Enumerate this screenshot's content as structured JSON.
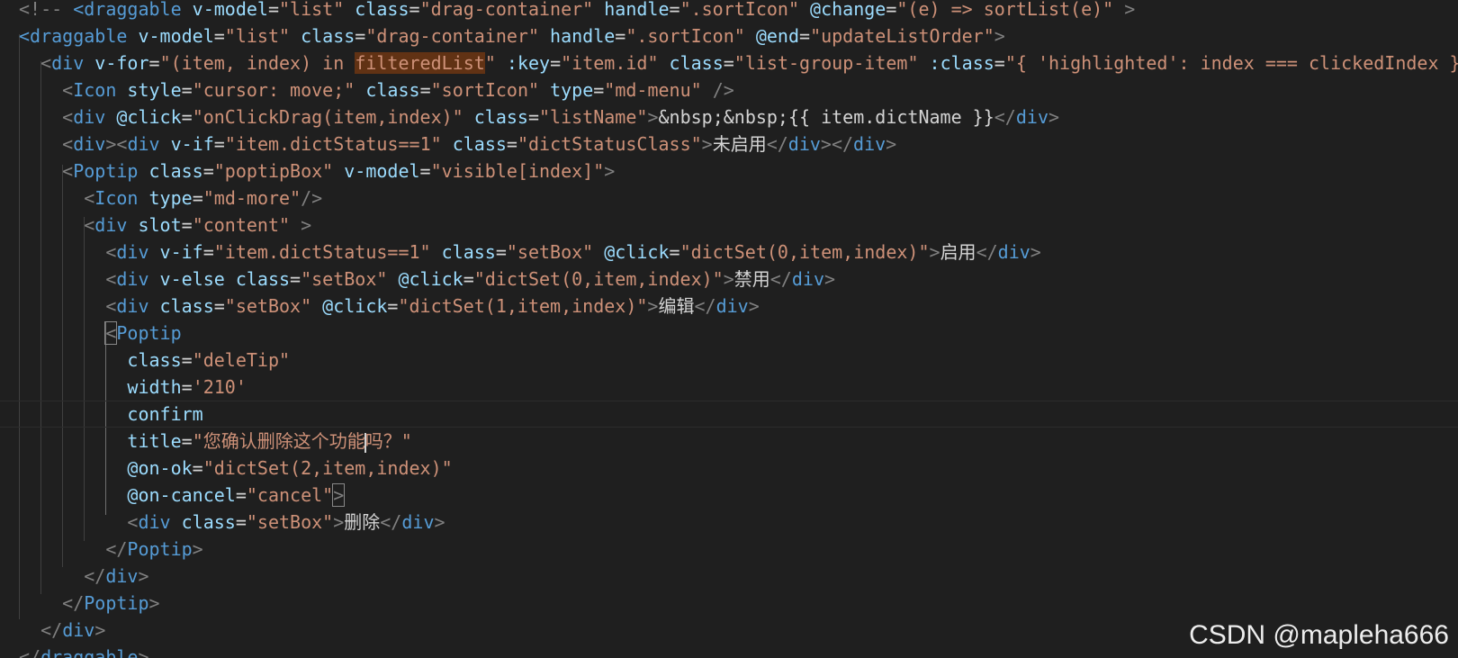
{
  "editor": {
    "language": "vue-template",
    "colors": {
      "background": "#1f1f1f",
      "tag": "#569cd6",
      "attribute": "#9cdcfe",
      "string": "#ce9178",
      "punctuation": "#808080",
      "text": "#d4d4d4",
      "function": "#dcdcaa",
      "number": "#b5cea8",
      "highlight": "#613214"
    },
    "cursor_line": 15,
    "lines": [
      [
        [
          "punc",
          "<!-- "
        ],
        [
          "tag",
          "<draggable"
        ],
        [
          "attr",
          " v-model"
        ],
        [
          "text",
          "="
        ],
        [
          "str",
          "\"list\""
        ],
        [
          "attr",
          " class"
        ],
        [
          "text",
          "="
        ],
        [
          "str",
          "\"drag-container\""
        ],
        [
          "attr",
          " handle"
        ],
        [
          "text",
          "="
        ],
        [
          "str",
          "\".sortIcon\""
        ],
        [
          "attr",
          " @change"
        ],
        [
          "text",
          "="
        ],
        [
          "str",
          "\"(e) => sortList(e)\""
        ],
        [
          "punc",
          " >"
        ]
      ],
      [
        [
          "tag",
          "<draggable"
        ],
        [
          "attr",
          " v-model"
        ],
        [
          "text",
          "="
        ],
        [
          "str",
          "\"list\""
        ],
        [
          "attr",
          " class"
        ],
        [
          "text",
          "="
        ],
        [
          "str",
          "\"drag-container\""
        ],
        [
          "attr",
          " handle"
        ],
        [
          "text",
          "="
        ],
        [
          "str",
          "\".sortIcon\""
        ],
        [
          "attr",
          " @end"
        ],
        [
          "text",
          "="
        ],
        [
          "str",
          "\"updateListOrder\""
        ],
        [
          "punc",
          ">"
        ]
      ],
      [
        [
          "text",
          "  "
        ],
        [
          "punc",
          "<"
        ],
        [
          "tag",
          "div"
        ],
        [
          "attr",
          " v-for"
        ],
        [
          "text",
          "="
        ],
        [
          "str",
          "\"(item, index) in "
        ],
        [
          "hl",
          "filteredList"
        ],
        [
          "str",
          "\""
        ],
        [
          "attr",
          " :key"
        ],
        [
          "text",
          "="
        ],
        [
          "str",
          "\"item.id\""
        ],
        [
          "attr",
          " class"
        ],
        [
          "text",
          "="
        ],
        [
          "str",
          "\"list-group-item\""
        ],
        [
          "attr",
          " :class"
        ],
        [
          "text",
          "="
        ],
        [
          "str",
          "\"{ 'highlighted': index === clickedIndex }\""
        ],
        [
          "punc",
          ">"
        ]
      ],
      [
        [
          "text",
          "    "
        ],
        [
          "punc",
          "<"
        ],
        [
          "tag",
          "Icon"
        ],
        [
          "attr",
          " style"
        ],
        [
          "text",
          "="
        ],
        [
          "str",
          "\"cursor: move;\""
        ],
        [
          "attr",
          " class"
        ],
        [
          "text",
          "="
        ],
        [
          "str",
          "\"sortIcon\""
        ],
        [
          "attr",
          " type"
        ],
        [
          "text",
          "="
        ],
        [
          "str",
          "\"md-menu\""
        ],
        [
          "punc",
          " />"
        ]
      ],
      [
        [
          "text",
          "    "
        ],
        [
          "punc",
          "<"
        ],
        [
          "tag",
          "div"
        ],
        [
          "attr",
          " @click"
        ],
        [
          "text",
          "="
        ],
        [
          "str",
          "\"onClickDrag(item,index)\""
        ],
        [
          "attr",
          " class"
        ],
        [
          "text",
          "="
        ],
        [
          "str",
          "\"listName\""
        ],
        [
          "punc",
          ">"
        ],
        [
          "text",
          "&nbsp;&nbsp;{{ item.dictName }}"
        ],
        [
          "punc",
          "</"
        ],
        [
          "tag",
          "div"
        ],
        [
          "punc",
          ">"
        ]
      ],
      [
        [
          "text",
          "    "
        ],
        [
          "punc",
          "<"
        ],
        [
          "tag",
          "div"
        ],
        [
          "punc",
          "><"
        ],
        [
          "tag",
          "div"
        ],
        [
          "attr",
          " v-if"
        ],
        [
          "text",
          "="
        ],
        [
          "str",
          "\"item.dictStatus==1\""
        ],
        [
          "attr",
          " class"
        ],
        [
          "text",
          "="
        ],
        [
          "str",
          "\"dictStatusClass\""
        ],
        [
          "punc",
          ">"
        ],
        [
          "text",
          "未启用"
        ],
        [
          "punc",
          "</"
        ],
        [
          "tag",
          "div"
        ],
        [
          "punc",
          "></"
        ],
        [
          "tag",
          "div"
        ],
        [
          "punc",
          ">"
        ]
      ],
      [
        [
          "text",
          "    "
        ],
        [
          "punc",
          "<"
        ],
        [
          "tag",
          "Poptip"
        ],
        [
          "attr",
          " class"
        ],
        [
          "text",
          "="
        ],
        [
          "str",
          "\"poptipBox\""
        ],
        [
          "attr",
          " v-model"
        ],
        [
          "text",
          "="
        ],
        [
          "str",
          "\"visible[index]\""
        ],
        [
          "punc",
          ">"
        ]
      ],
      [
        [
          "text",
          "      "
        ],
        [
          "punc",
          "<"
        ],
        [
          "tag",
          "Icon"
        ],
        [
          "attr",
          " type"
        ],
        [
          "text",
          "="
        ],
        [
          "str",
          "\"md-more\""
        ],
        [
          "punc",
          "/>"
        ]
      ],
      [
        [
          "text",
          "      "
        ],
        [
          "punc",
          "<"
        ],
        [
          "tag",
          "div"
        ],
        [
          "attr",
          " slot"
        ],
        [
          "text",
          "="
        ],
        [
          "str",
          "\"content\""
        ],
        [
          "punc",
          " >"
        ]
      ],
      [
        [
          "text",
          "        "
        ],
        [
          "punc",
          "<"
        ],
        [
          "tag",
          "div"
        ],
        [
          "attr",
          " v-if"
        ],
        [
          "text",
          "="
        ],
        [
          "str",
          "\"item.dictStatus==1\""
        ],
        [
          "attr",
          " class"
        ],
        [
          "text",
          "="
        ],
        [
          "str",
          "\"setBox\""
        ],
        [
          "attr",
          " @click"
        ],
        [
          "text",
          "="
        ],
        [
          "str",
          "\"dictSet(0,item,index)\""
        ],
        [
          "punc",
          ">"
        ],
        [
          "text",
          "启用"
        ],
        [
          "punc",
          "</"
        ],
        [
          "tag",
          "div"
        ],
        [
          "punc",
          ">"
        ]
      ],
      [
        [
          "text",
          "        "
        ],
        [
          "punc",
          "<"
        ],
        [
          "tag",
          "div"
        ],
        [
          "attr",
          " v-else"
        ],
        [
          "attr",
          " class"
        ],
        [
          "text",
          "="
        ],
        [
          "str",
          "\"setBox\""
        ],
        [
          "attr",
          " @click"
        ],
        [
          "text",
          "="
        ],
        [
          "str",
          "\"dictSet(0,item,index)\""
        ],
        [
          "punc",
          ">"
        ],
        [
          "text",
          "禁用"
        ],
        [
          "punc",
          "</"
        ],
        [
          "tag",
          "div"
        ],
        [
          "punc",
          ">"
        ]
      ],
      [
        [
          "text",
          "        "
        ],
        [
          "punc",
          "<"
        ],
        [
          "tag",
          "div"
        ],
        [
          "attr",
          " class"
        ],
        [
          "text",
          "="
        ],
        [
          "str",
          "\"setBox\""
        ],
        [
          "attr",
          " @click"
        ],
        [
          "text",
          "="
        ],
        [
          "str",
          "\"dictSet(1,item,index)\""
        ],
        [
          "punc",
          ">"
        ],
        [
          "text",
          "编辑"
        ],
        [
          "punc",
          "</"
        ],
        [
          "tag",
          "div"
        ],
        [
          "punc",
          ">"
        ]
      ],
      [
        [
          "text",
          "        "
        ],
        [
          "bracket",
          "<"
        ],
        [
          "tag",
          "Poptip"
        ]
      ],
      [
        [
          "text",
          "          "
        ],
        [
          "attr",
          "class"
        ],
        [
          "text",
          "="
        ],
        [
          "str",
          "\"deleTip\""
        ]
      ],
      [
        [
          "text",
          "          "
        ],
        [
          "attr",
          "width"
        ],
        [
          "text",
          "="
        ],
        [
          "str",
          "'210'"
        ]
      ],
      [
        [
          "text",
          "          "
        ],
        [
          "attr",
          "confirm"
        ]
      ],
      [
        [
          "text",
          "          "
        ],
        [
          "attr",
          "title"
        ],
        [
          "text",
          "="
        ],
        [
          "str",
          "\"您确认删除这个功能"
        ],
        [
          "cursor",
          ""
        ],
        [
          "str",
          "吗？\""
        ]
      ],
      [
        [
          "text",
          "          "
        ],
        [
          "attr",
          "@on-ok"
        ],
        [
          "text",
          "="
        ],
        [
          "str",
          "\"dictSet(2,item,index)\""
        ]
      ],
      [
        [
          "text",
          "          "
        ],
        [
          "attr",
          "@on-cancel"
        ],
        [
          "text",
          "="
        ],
        [
          "str",
          "\"cancel\""
        ],
        [
          "bracket",
          ">"
        ]
      ],
      [
        [
          "text",
          "          "
        ],
        [
          "punc",
          "<"
        ],
        [
          "tag",
          "div"
        ],
        [
          "attr",
          " class"
        ],
        [
          "text",
          "="
        ],
        [
          "str",
          "\"setBox\""
        ],
        [
          "punc",
          ">"
        ],
        [
          "text",
          "删除"
        ],
        [
          "punc",
          "</"
        ],
        [
          "tag",
          "div"
        ],
        [
          "punc",
          ">"
        ]
      ],
      [
        [
          "text",
          "        "
        ],
        [
          "punc",
          "</"
        ],
        [
          "tag",
          "Poptip"
        ],
        [
          "punc",
          ">"
        ]
      ],
      [
        [
          "text",
          "      "
        ],
        [
          "punc",
          "</"
        ],
        [
          "tag",
          "div"
        ],
        [
          "punc",
          ">"
        ]
      ],
      [
        [
          "text",
          "    "
        ],
        [
          "punc",
          "</"
        ],
        [
          "tag",
          "Poptip"
        ],
        [
          "punc",
          ">"
        ]
      ],
      [
        [
          "text",
          "  "
        ],
        [
          "punc",
          "</"
        ],
        [
          "tag",
          "div"
        ],
        [
          "punc",
          ">"
        ]
      ],
      [
        [
          "punc",
          "</"
        ],
        [
          "tag",
          "draggable"
        ],
        [
          "punc",
          ">"
        ]
      ]
    ]
  },
  "watermark": {
    "text": "CSDN @mapleha666"
  }
}
